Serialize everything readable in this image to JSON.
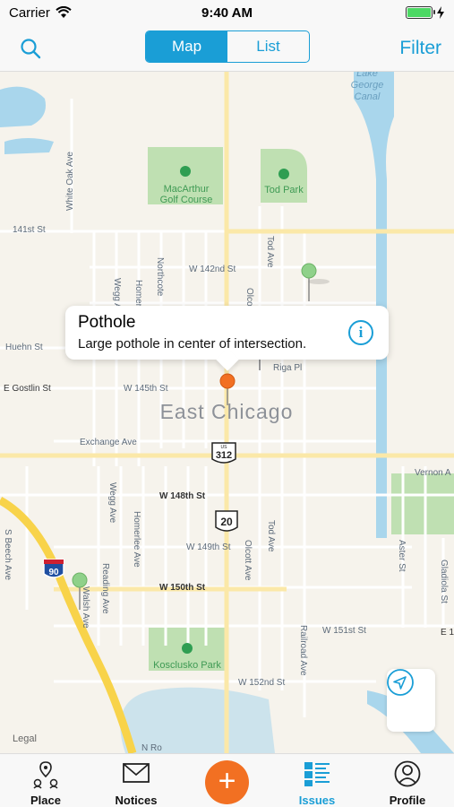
{
  "status_bar": {
    "carrier": "Carrier",
    "time": "9:40 AM"
  },
  "nav": {
    "segments": [
      "Map",
      "List"
    ],
    "active_segment": "Map",
    "filter_label": "Filter"
  },
  "map": {
    "labels": {
      "lake_george_canal_1": "Lake",
      "lake_george_canal_2": "George",
      "lake_george_canal_3": "Canal",
      "white_oak_ave": "White Oak Ave",
      "macarthur_1": "MacArthur",
      "macarthur_2": "Golf Course",
      "tod_park": "Tod Park",
      "st_141": "141st St",
      "wegg_ave": "Wegg Ave",
      "homerlee_ave": "Homerlee",
      "northcote_ave": "Northcote",
      "w_142nd_st": "W 142nd St",
      "tod_ave": "Tod Ave",
      "olcott_ave": "Olcott",
      "huehn_st": "Huehn St",
      "riga_pl": "Riga Pl",
      "e_gostlin_st": "E Gostlin St",
      "w_145th_st": "W 145th St",
      "east_chicago": "East Chicago",
      "exchange_ave": "Exchange Ave",
      "us_312": "312",
      "us_label": "US",
      "vernon_a": "Vernon A",
      "w_148th_st": "W 148th St",
      "wegg_ave_2": "Wegg Ave",
      "homerlee_ave_2": "Homerlee Ave",
      "us_20": "20",
      "s_beech_ave": "S Beech Ave",
      "i_90": "90",
      "w_149th_st": "W 149th St",
      "olcott_ave_2": "Olcott Ave",
      "tod_ave_2": "Tod Ave",
      "aster_st": "Aster St",
      "gladiola_st": "Gladiola St",
      "reading_ave": "Reading Ave",
      "walsh_ave": "Walsh Ave",
      "w_150th_st": "W 150th St",
      "w_151st_st": "W 151st St",
      "e_1": "E 1",
      "railroad_ave": "Railroad Ave",
      "kosciusko_park": "Kosclusko Park",
      "w_152nd_st": "W 152nd St",
      "n_ro": "N Ro",
      "legal": "Legal"
    }
  },
  "callout": {
    "title": "Pothole",
    "description": "Large pothole in center of intersection."
  },
  "tabs": [
    {
      "label": "Place",
      "icon": "place-icon"
    },
    {
      "label": "Notices",
      "icon": "envelope-icon"
    },
    {
      "label": "Issues",
      "icon": "issues-list-icon",
      "active": true
    },
    {
      "label": "Profile",
      "icon": "profile-icon"
    }
  ],
  "add_button": {
    "label": "+"
  },
  "colors": {
    "accent": "#1a9ed6",
    "orange": "#f27022",
    "pin_green": "#8fd18a",
    "water": "#a9d6ec",
    "park": "#bfe0b2",
    "highway": "#f8d34a",
    "road_major": "#fbe8a8"
  }
}
